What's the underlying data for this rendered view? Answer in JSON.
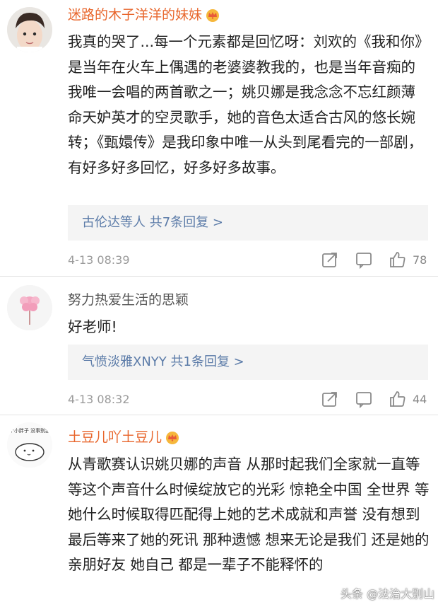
{
  "comments": [
    {
      "username": "迷路的木子洋洋的妹妹",
      "text": "我真的哭了...每一个元素都是回忆呀：刘欢的《我和你》是当年在火车上偶遇的老婆婆教我的，也是当年音痴的我唯一会唱的两首歌之一；姚贝娜是我念念不忘红颜薄命天妒英才的空灵歌手，她的音色太适合古风的悠长婉转；《甄嬛传》是我印象中唯一从头到尾看完的一部剧，有好多好多回忆，好多好多故事。",
      "replies": "古伦达等人 共7条回复 >",
      "time": "4-13 08:39",
      "likes": "78"
    },
    {
      "username": "努力热爱生活的思颖",
      "text": "好老师!",
      "replies": "气愤淡雅XNYY 共1条回复 >",
      "time": "4-13 08:32",
      "likes": "44"
    },
    {
      "username": "土豆儿吖土豆儿",
      "avatar_text": "送一个小胖子 没事别乱摸他",
      "text": "从青歌赛认识姚贝娜的声音 从那时起我们全家就一直等 等这个声音什么时候绽放它的光彩 惊艳全中国 全世界 等她什么时候取得匹配得上她的艺术成就和声誉 没有想到最后等来了她的死讯 那种遗憾 想来无论是我们 还是她的亲朋好友 她自己 都是一辈子不能释怀的"
    }
  ],
  "watermark": "头条 @法治大别山",
  "colors": {
    "vip_name": "#e8662c",
    "link": "#5b7ba8",
    "reply_bg": "#f4f4f4",
    "meta": "#9a9a9a"
  },
  "icons": [
    "crown-icon",
    "share-icon",
    "comment-icon",
    "like-icon"
  ]
}
